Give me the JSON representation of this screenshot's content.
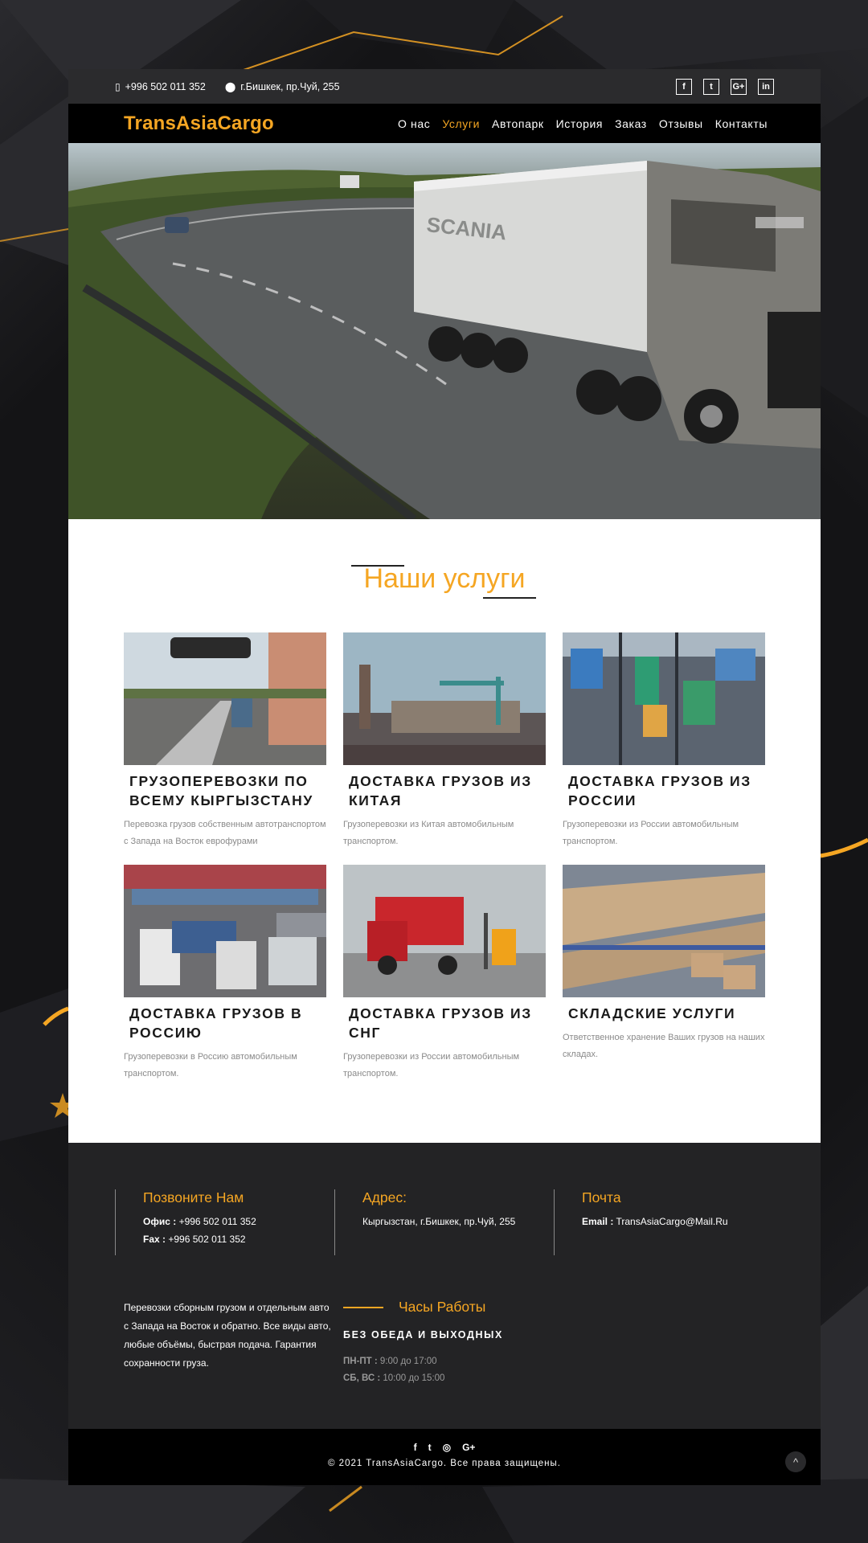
{
  "topbar": {
    "phone": "+996 502 011 352",
    "address": "г.Бишкек, пр.Чуй, 255",
    "social": [
      "f",
      "t",
      "G+",
      "in"
    ]
  },
  "nav": {
    "logo": "TransAsiaCargo",
    "items": [
      {
        "label": "О нас",
        "active": false
      },
      {
        "label": "Услуги",
        "active": true
      },
      {
        "label": "Автопарк",
        "active": false
      },
      {
        "label": "История",
        "active": false
      },
      {
        "label": "Заказ",
        "active": false
      },
      {
        "label": "Отзывы",
        "active": false
      },
      {
        "label": "Контакты",
        "active": false
      }
    ]
  },
  "services": {
    "title": "Наши услуги",
    "items": [
      {
        "title": "ГРУЗОПЕРЕВОЗКИ ПО ВСЕМУ КЫРГЫЗСТАНУ",
        "text": "Перевозка грузов собственным автотранспортом с Запада на Восток еврофурами"
      },
      {
        "title": "ДОСТАВКА ГРУЗОВ ИЗ КИТАЯ",
        "text": "Грузоперевозки из Китая автомобильным транспортом."
      },
      {
        "title": "ДОСТАВКА ГРУЗОВ ИЗ РОССИИ",
        "text": "Грузоперевозки из России автомобильным транспортом."
      },
      {
        "title": "ДОСТАВКА ГРУЗОВ В РОССИЮ",
        "text": "Грузоперевозки в Россию автомобильным транспортом."
      },
      {
        "title": "ДОСТАВКА ГРУЗОВ ИЗ СНГ",
        "text": "Грузоперевозки из России автомобильным транспортом."
      },
      {
        "title": "СКЛАДСКИЕ УСЛУГИ",
        "text": "Ответственное хранение Ваших грузов на наших складах."
      }
    ]
  },
  "contacts": {
    "call": {
      "title": "Позвоните Нам",
      "office_label": "Офис :",
      "office": "+996 502 011 352",
      "fax_label": "Fax :",
      "fax": "+996 502 011 352"
    },
    "address": {
      "title": "Адрес:",
      "value": "Кыргызстан, г.Бишкек, пр.Чуй, 255"
    },
    "mail": {
      "title": "Почта",
      "email_label": "Email :",
      "email": "TransAsiaCargo@Mail.Ru"
    }
  },
  "about": "Перевозки сборным грузом и отдельным авто с Запада на Восток и обратно. Все виды авто, любые объёмы, быстрая подача. Гарантия сохранности груза.",
  "hours": {
    "title": "Часы Работы",
    "subtitle": "БЕЗ ОБЕДА И ВЫХОДНЫХ",
    "weekdays_label": "ПН-ПТ :",
    "weekdays": "9:00 до 17:00",
    "weekend_label": "СБ, ВС :",
    "weekend": "10:00 до 15:00"
  },
  "footer": {
    "social": [
      "f",
      "t",
      "◎",
      "G+"
    ],
    "copyright": "© 2021 TransAsiaCargo. Все права защищены.",
    "totop_icon": "^"
  },
  "colors": {
    "accent": "#f5a623",
    "dark": "#232325",
    "black": "#000000"
  }
}
